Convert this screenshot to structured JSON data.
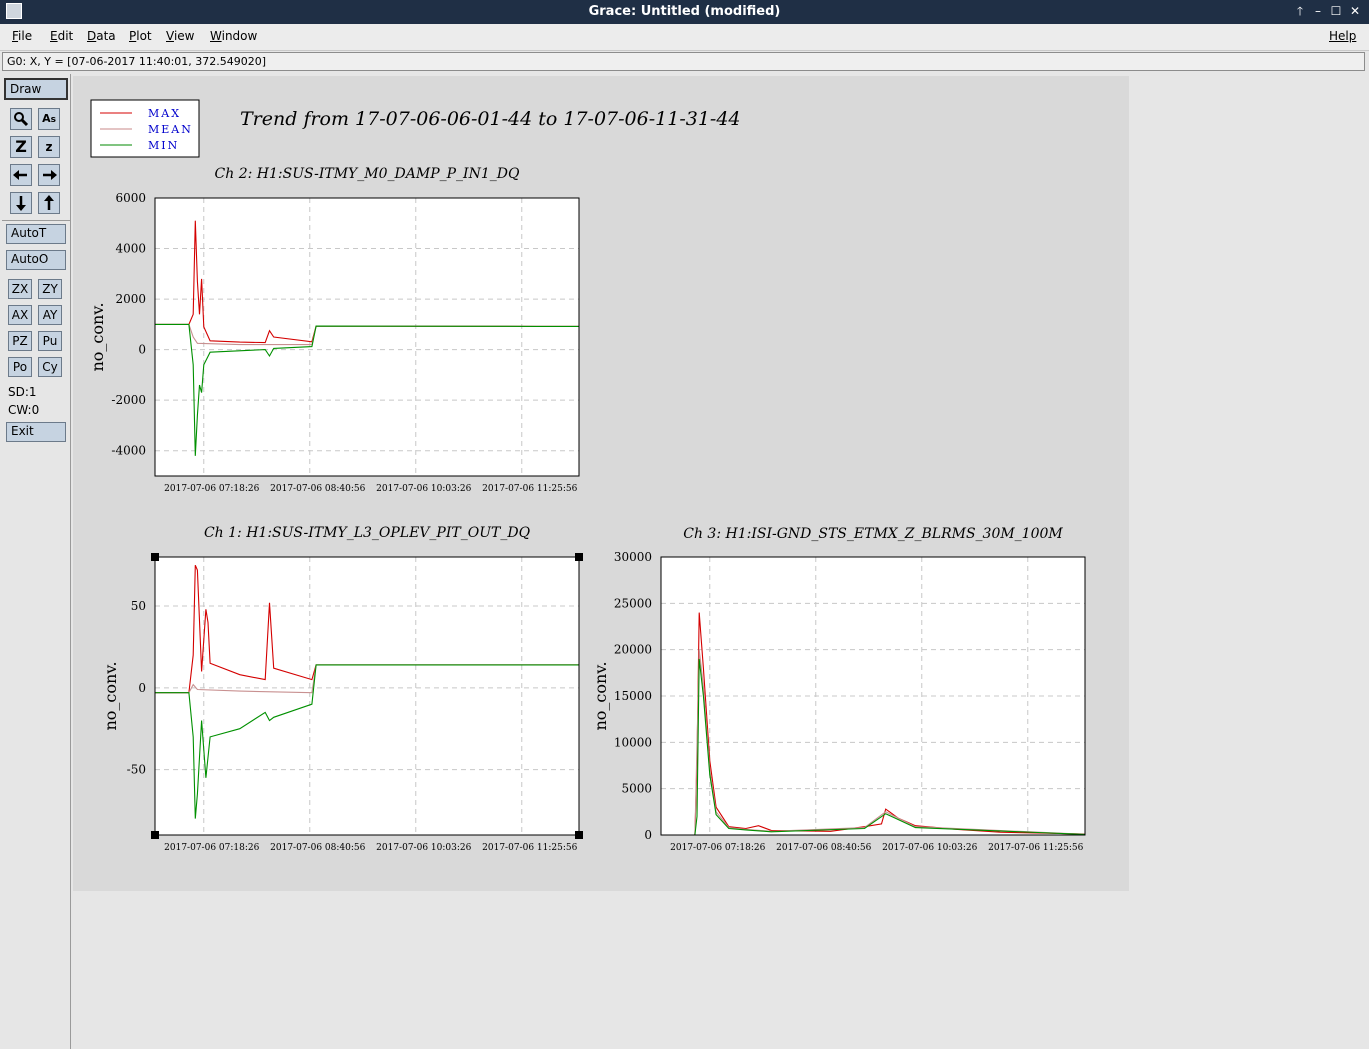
{
  "window": {
    "title": "Grace: Untitled (modified)",
    "buttons": [
      "🡑",
      "–",
      "☐",
      "✕"
    ]
  },
  "menubar": {
    "items": [
      {
        "label": "File",
        "u": "F",
        "rest": "ile"
      },
      {
        "label": "Edit",
        "u": "E",
        "rest": "dit"
      },
      {
        "label": "Data",
        "u": "D",
        "rest": "ata"
      },
      {
        "label": "Plot",
        "u": "P",
        "rest": "lot"
      },
      {
        "label": "View",
        "u": "V",
        "rest": "iew"
      },
      {
        "label": "Window",
        "u": "W",
        "rest": "indow"
      }
    ],
    "help": "Help"
  },
  "locator": "G0: X, Y = [07-06-2017 11:40:01, 372.549020]",
  "toolbar": {
    "draw": "Draw",
    "icons": [
      "zoom-icon",
      "text-icon",
      "zoom-in-icon",
      "zoom-out-icon",
      "left-arrow-icon",
      "right-arrow-icon",
      "down-arrow-icon",
      "up-arrow-icon"
    ],
    "autot": "AutoT",
    "autoo": "AutoO",
    "small": [
      "ZX",
      "ZY",
      "AX",
      "AY",
      "PZ",
      "Pu",
      "Po",
      "Cy"
    ],
    "sd": "SD:1",
    "cw": "CW:0",
    "exit": "Exit"
  },
  "plot": {
    "title": "Trend from 17-07-06-06-01-44 to 17-07-06-11-31-44",
    "legend": [
      {
        "label": "MAX",
        "color": "#d40000"
      },
      {
        "label": "MEAN",
        "color": "#c88a8a"
      },
      {
        "label": "MIN",
        "color": "#008a00"
      }
    ],
    "colors": {
      "max": "#d40000",
      "mean": "#c89090",
      "min": "#009000",
      "legend_text": "#0000cc"
    }
  },
  "chart_data": [
    {
      "type": "line",
      "title": "Ch 2: H1:SUS-ITMY_M0_DAMP_P_IN1_DQ",
      "ylabel": "no_conv.",
      "xticks": [
        "2017-07-06 07:18:26",
        "2017-07-06 08:40:56",
        "2017-07-06 10:03:26",
        "2017-07-06 11:25:56"
      ],
      "yticks": [
        "6000",
        "4000",
        "2000",
        "0",
        "-2000",
        "-4000"
      ],
      "ylim": [
        -5000,
        6000
      ],
      "series": [
        {
          "name": "MAX",
          "color": "#d40000",
          "values": [
            [
              0,
              1000
            ],
            [
              0.08,
              1000
            ],
            [
              0.09,
              1400
            ],
            [
              0.095,
              5100
            ],
            [
              0.1,
              2700
            ],
            [
              0.105,
              1400
            ],
            [
              0.11,
              2800
            ],
            [
              0.115,
              900
            ],
            [
              0.13,
              350
            ],
            [
              0.2,
              300
            ],
            [
              0.26,
              280
            ],
            [
              0.27,
              750
            ],
            [
              0.28,
              500
            ],
            [
              0.37,
              310
            ],
            [
              0.38,
              930
            ],
            [
              0.9,
              920
            ],
            [
              1,
              920
            ]
          ]
        },
        {
          "name": "MEAN",
          "color": "#c89090",
          "values": [
            [
              0,
              1000
            ],
            [
              0.08,
              1000
            ],
            [
              0.09,
              500
            ],
            [
              0.1,
              250
            ],
            [
              0.2,
              200
            ],
            [
              0.37,
              200
            ],
            [
              0.38,
              930
            ],
            [
              1,
              920
            ]
          ]
        },
        {
          "name": "MIN",
          "color": "#009000",
          "values": [
            [
              0,
              1000
            ],
            [
              0.08,
              1000
            ],
            [
              0.09,
              -600
            ],
            [
              0.095,
              -4200
            ],
            [
              0.1,
              -2600
            ],
            [
              0.105,
              -1400
            ],
            [
              0.11,
              -1700
            ],
            [
              0.115,
              -600
            ],
            [
              0.13,
              -100
            ],
            [
              0.26,
              0
            ],
            [
              0.27,
              -250
            ],
            [
              0.28,
              50
            ],
            [
              0.37,
              120
            ],
            [
              0.38,
              930
            ],
            [
              0.9,
              920
            ],
            [
              1,
              920
            ]
          ]
        }
      ]
    },
    {
      "type": "line",
      "title": "Ch 1: H1:SUS-ITMY_L3_OPLEV_PIT_OUT_DQ",
      "ylabel": "no_conv.",
      "xticks": [
        "2017-07-06 07:18:26",
        "2017-07-06 08:40:56",
        "2017-07-06 10:03:26",
        "2017-07-06 11:25:56"
      ],
      "yticks": [
        "50",
        "0",
        "-50"
      ],
      "ylim": [
        -90,
        80
      ],
      "series": [
        {
          "name": "MAX",
          "color": "#d40000",
          "values": [
            [
              0,
              -3
            ],
            [
              0.08,
              -3
            ],
            [
              0.09,
              20
            ],
            [
              0.095,
              75
            ],
            [
              0.1,
              72
            ],
            [
              0.11,
              10
            ],
            [
              0.12,
              48
            ],
            [
              0.125,
              40
            ],
            [
              0.13,
              15
            ],
            [
              0.2,
              8
            ],
            [
              0.26,
              5
            ],
            [
              0.27,
              52
            ],
            [
              0.28,
              12
            ],
            [
              0.37,
              5
            ],
            [
              0.38,
              14
            ],
            [
              1,
              14
            ]
          ]
        },
        {
          "name": "MEAN",
          "color": "#c89090",
          "values": [
            [
              0,
              -3
            ],
            [
              0.08,
              -3
            ],
            [
              0.09,
              2
            ],
            [
              0.1,
              -1
            ],
            [
              0.2,
              -2
            ],
            [
              0.37,
              -3
            ],
            [
              0.38,
              14
            ],
            [
              1,
              14
            ]
          ]
        },
        {
          "name": "MIN",
          "color": "#009000",
          "values": [
            [
              0,
              -3
            ],
            [
              0.08,
              -3
            ],
            [
              0.09,
              -30
            ],
            [
              0.095,
              -80
            ],
            [
              0.1,
              -65
            ],
            [
              0.11,
              -20
            ],
            [
              0.12,
              -55
            ],
            [
              0.13,
              -30
            ],
            [
              0.2,
              -25
            ],
            [
              0.26,
              -15
            ],
            [
              0.27,
              -20
            ],
            [
              0.28,
              -18
            ],
            [
              0.37,
              -10
            ],
            [
              0.38,
              14
            ],
            [
              1,
              14
            ]
          ]
        }
      ]
    },
    {
      "type": "line",
      "title": "Ch 3: H1:ISI-GND_STS_ETMX_Z_BLRMS_30M_100M",
      "ylabel": "no_conv.",
      "xticks": [
        "2017-07-06 07:18:26",
        "2017-07-06 08:40:56",
        "2017-07-06 10:03:26",
        "2017-07-06 11:25:56"
      ],
      "yticks": [
        "30000",
        "25000",
        "20000",
        "15000",
        "10000",
        "5000",
        "0"
      ],
      "ylim": [
        0,
        30000
      ],
      "series": [
        {
          "name": "MAX",
          "color": "#d40000",
          "values": [
            [
              0.08,
              0
            ],
            [
              0.085,
              8000
            ],
            [
              0.09,
              24000
            ],
            [
              0.1,
              18000
            ],
            [
              0.115,
              8000
            ],
            [
              0.13,
              3000
            ],
            [
              0.16,
              900
            ],
            [
              0.2,
              700
            ],
            [
              0.23,
              1000
            ],
            [
              0.26,
              500
            ],
            [
              0.4,
              400
            ],
            [
              0.48,
              900
            ],
            [
              0.52,
              1200
            ],
            [
              0.53,
              2800
            ],
            [
              0.56,
              1800
            ],
            [
              0.6,
              1000
            ],
            [
              0.7,
              600
            ],
            [
              0.8,
              300
            ],
            [
              0.9,
              200
            ],
            [
              1,
              100
            ]
          ]
        },
        {
          "name": "MEAN",
          "color": "#c89090",
          "values": [
            [
              0.08,
              0
            ],
            [
              0.09,
              20000
            ],
            [
              0.1,
              16000
            ],
            [
              0.115,
              7000
            ],
            [
              0.13,
              2500
            ],
            [
              0.16,
              800
            ],
            [
              0.2,
              600
            ],
            [
              0.26,
              400
            ],
            [
              0.48,
              800
            ],
            [
              0.53,
              2500
            ],
            [
              0.6,
              900
            ],
            [
              1,
              80
            ]
          ]
        },
        {
          "name": "MIN",
          "color": "#009000",
          "values": [
            [
              0.08,
              0
            ],
            [
              0.085,
              2000
            ],
            [
              0.09,
              19000
            ],
            [
              0.1,
              15000
            ],
            [
              0.115,
              6500
            ],
            [
              0.13,
              2200
            ],
            [
              0.16,
              700
            ],
            [
              0.2,
              550
            ],
            [
              0.26,
              350
            ],
            [
              0.48,
              700
            ],
            [
              0.53,
              2300
            ],
            [
              0.6,
              800
            ],
            [
              1,
              60
            ]
          ]
        }
      ]
    }
  ]
}
